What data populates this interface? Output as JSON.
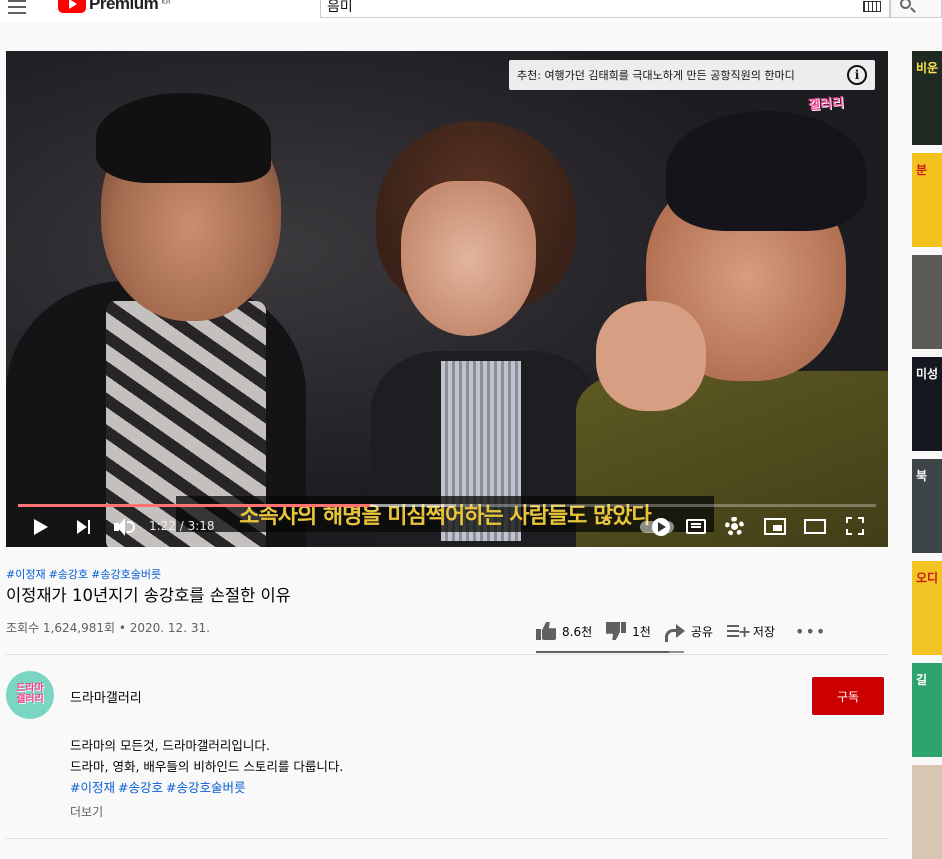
{
  "header": {
    "logo_text": "Premium",
    "logo_suffix": "KR",
    "search_value": "음미"
  },
  "player": {
    "recommendation_text": "추천: 여행가던 김태희를 극대노하게 만든 공항직원의 한마디",
    "watermark": "갤러리",
    "subtitle": "소속사의 해명을 미심쩍어하는 사람들도 많았다",
    "time_display": "1:22 / 3:18",
    "progress_fraction": 0.41,
    "buffer_fraction": 0.51
  },
  "video": {
    "hashtags": [
      "#이정재",
      "#송강호",
      "#송강호술버릇"
    ],
    "title": "이정재가 10년지기 송강호를 손절한 이유",
    "meta": "조회수 1,624,981회 • 2020. 12. 31.",
    "actions": {
      "like": "8.6천",
      "dislike": "1천",
      "share": "공유",
      "save": "저장",
      "more": "•••"
    },
    "like_ratio": 0.9
  },
  "channel": {
    "avatar_text": "드라마 갤러리",
    "name": "드라마갤러리",
    "subscribe_label": "구독",
    "description_line1": "드라마의 모든것, 드라마갤러리입니다.",
    "description_line2": "드라마, 영화, 배우들의 비하인드 스토리를 다룹니다.",
    "description_tags": [
      "#이정재",
      "#송강호",
      "#송강호술버릇"
    ],
    "more_label": "더보기"
  },
  "sidebar": {
    "items": [
      {
        "text": "비운",
        "bg": "#1e2a22",
        "color": "#ffe44d"
      },
      {
        "text": "분",
        "bg": "#f4c21f",
        "color": "#d0191f"
      },
      {
        "text": "",
        "bg": "#5b5c55",
        "color": "#ffffff"
      },
      {
        "text": "미성",
        "bg": "#14181f",
        "color": "#ffffff"
      },
      {
        "text": "북",
        "bg": "#3e4548",
        "color": "#ffffff"
      },
      {
        "text": "오디",
        "bg": "#f2c524",
        "color": "#c41a1a"
      },
      {
        "text": "길",
        "bg": "#2ea36d",
        "color": "#ffffff"
      },
      {
        "text": "",
        "bg": "#d8c6b2",
        "color": "#222222"
      }
    ]
  }
}
